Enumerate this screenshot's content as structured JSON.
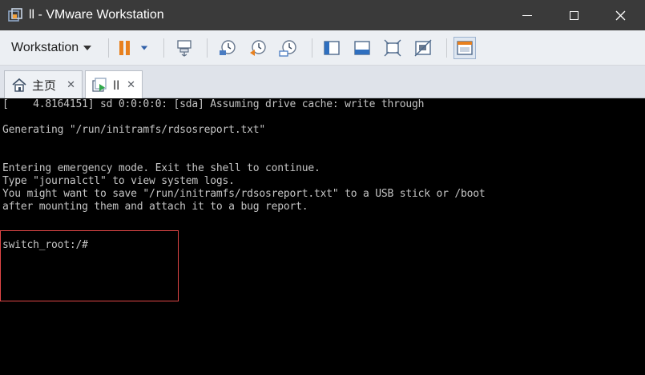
{
  "window": {
    "title": "ll - VMware Workstation",
    "minimize": "minimize",
    "maximize": "maximize",
    "close": "close"
  },
  "toolbar": {
    "workstation_menu": "Workstation",
    "icons": [
      "pause-icon",
      "dropdown-arrow-icon",
      "send-ctrl-alt-del-icon",
      "snapshot-icon",
      "revert-snapshot-icon",
      "snapshot-manager-icon",
      "show-library-icon",
      "thumbnail-bar-icon",
      "full-screen-icon",
      "unity-icon",
      "console-view-icon"
    ]
  },
  "tabs": [
    {
      "label": "主页",
      "icon": "home-icon",
      "active": false
    },
    {
      "label": "ll",
      "icon": "vm-running-icon",
      "active": true
    }
  ],
  "console": {
    "lines": [
      "[    4.8164151] sd 0:0:0:0: [sda] Assuming drive cache: write through",
      "",
      "Generating \"/run/initramfs/rdsosreport.txt\"",
      "",
      "",
      "Entering emergency mode. Exit the shell to continue.",
      "Type \"journalctl\" to view system logs.",
      "You might want to save \"/run/initramfs/rdsosreport.txt\" to a USB stick or /boot",
      "after mounting them and attach it to a bug report.",
      "",
      "",
      "switch_root:/#"
    ]
  },
  "colors": {
    "titlebar": "#3a3a3a",
    "toolbar": "#eceff3",
    "console_bg": "#000000",
    "console_text": "#c4c4c4",
    "highlight": "#e04646",
    "pause_orange": "#e8801e"
  }
}
